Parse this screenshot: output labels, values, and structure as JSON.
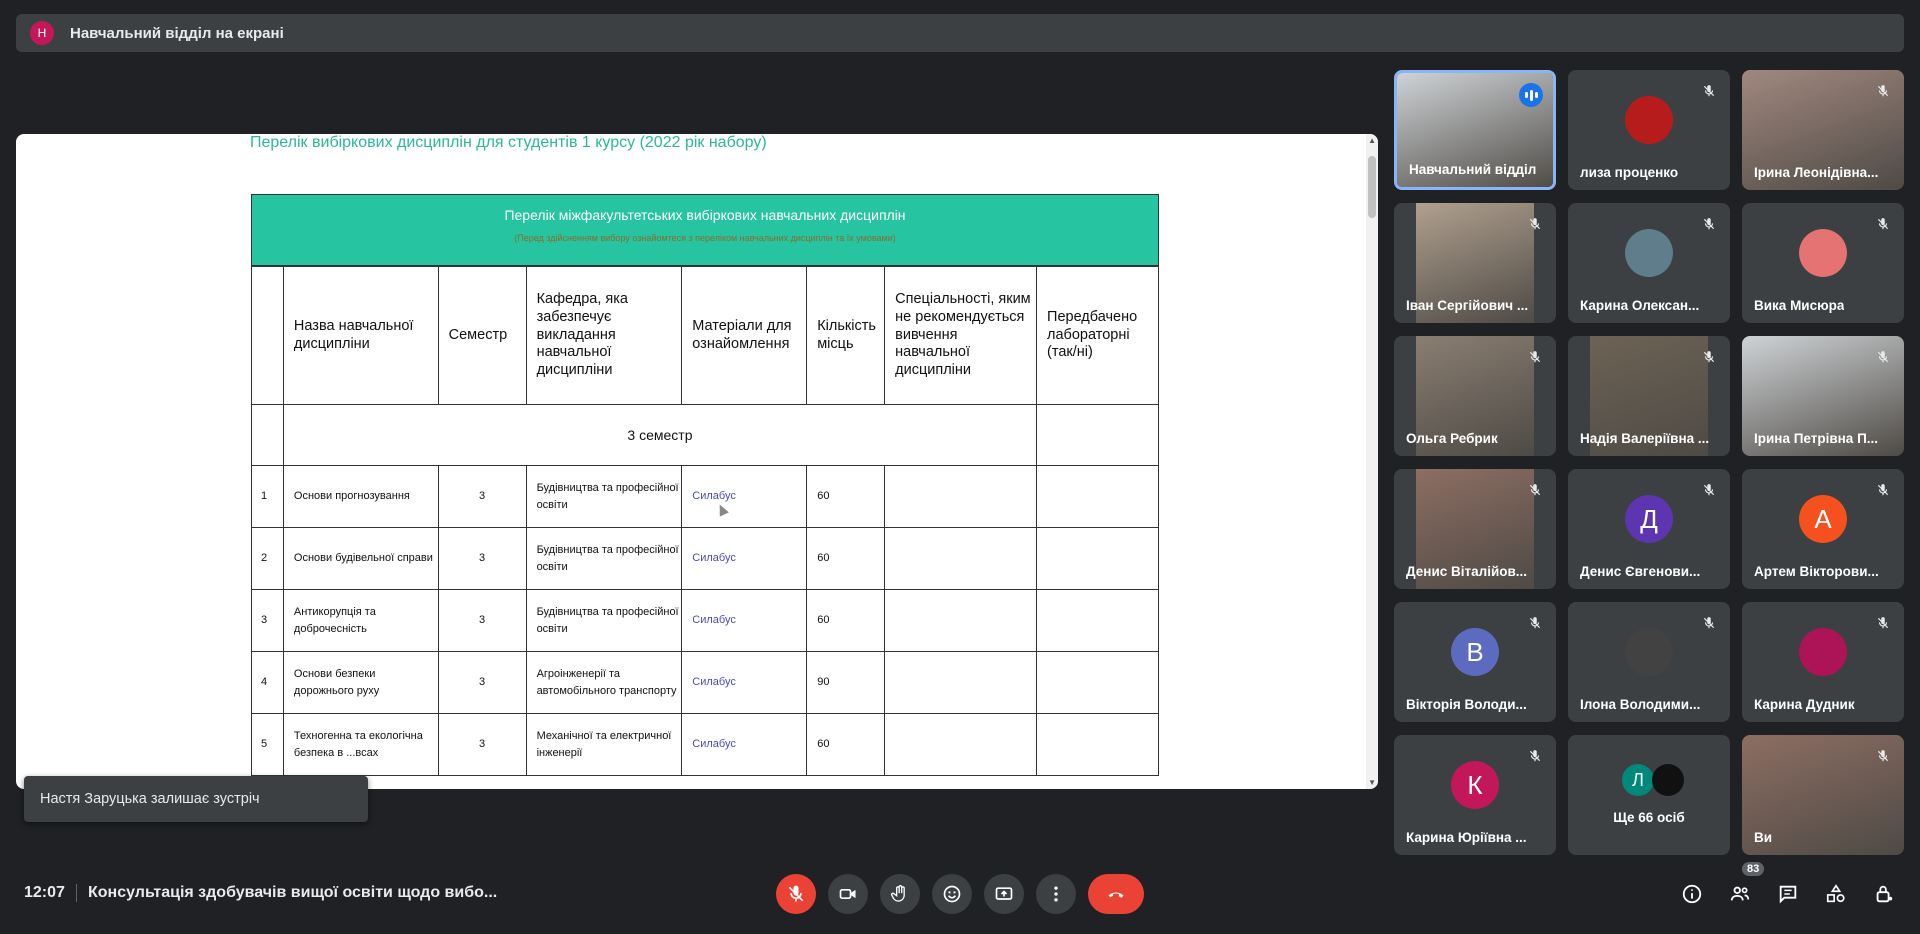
{
  "presenter": {
    "initial": "Н",
    "text": "Навчальний відділ на екрані"
  },
  "document": {
    "title": "Перелік вибіркових дисциплін для студентів 1 курсу (2022 рік набору)",
    "table_title": "Перелік міжфакультетських вибіркових навчальних дисциплін",
    "table_subtitle": "(Перед здійсненням вибору ознайомтеся з переліком навчальних дисциплін та їх умовами)",
    "headers": [
      "",
      "Назва навчальної дисципліни",
      "Семестр",
      "Кафедра, яка забезпечує викладання навчальної дисципліни",
      "Матеріали для ознайомлення",
      "Кількість місць",
      "Спеціальності, яким не рекомендується вивчення навчальної дисципліни",
      "Передбачено лабораторні (так/ні)"
    ],
    "semester_label": "3 семестр",
    "rows": [
      {
        "num": "1",
        "name": "Основи прогнозування",
        "sem": "3",
        "dept": "Будівництва та професійної освіти",
        "link": "Силабус",
        "places": "60"
      },
      {
        "num": "2",
        "name": "Основи будівельної справи",
        "sem": "3",
        "dept": "Будівництва та професійної освіти",
        "link": "Силабус",
        "places": "60"
      },
      {
        "num": "3",
        "name": "Антикорупція та доброчесність",
        "sem": "3",
        "dept": "Будівництва та професійної освіти",
        "link": "Силабус",
        "places": "60"
      },
      {
        "num": "4",
        "name": "Основи безпеки дорожнього руху",
        "sem": "3",
        "dept": "Агроінженерії та автомобільного транспорту",
        "link": "Силабус",
        "places": "90"
      },
      {
        "num": "5",
        "name": "Техногенна та екологічна безпека в ...всах",
        "sem": "3",
        "dept": "Механічної та електричної інженерії",
        "link": "Силабус",
        "places": "60"
      }
    ]
  },
  "toast": "Настя Заруцька залишає зустріч",
  "participants": [
    {
      "name": "Навчальний відділ",
      "kind": "camera",
      "speaking": true
    },
    {
      "name": "лиза проценко",
      "kind": "photo",
      "color": "#b71c1c"
    },
    {
      "name": "Ірина Леонідівна...",
      "kind": "camera"
    },
    {
      "name": "Іван Сергійович ...",
      "kind": "camera"
    },
    {
      "name": "Карина Олексан...",
      "kind": "photo",
      "color": "#607d8b"
    },
    {
      "name": "Вика Мисюра",
      "kind": "photo",
      "color": "#e57373"
    },
    {
      "name": "Ольга Ребрик",
      "kind": "camera"
    },
    {
      "name": "Надія Валеріївна ...",
      "kind": "camera"
    },
    {
      "name": "Ірина Петрівна П...",
      "kind": "camera"
    },
    {
      "name": "Денис Віталійов...",
      "kind": "camera"
    },
    {
      "name": "Денис Євгенови...",
      "kind": "letter",
      "letter": "Д",
      "color": "#5e35b1"
    },
    {
      "name": "Артем Вікторови...",
      "kind": "letter",
      "letter": "А",
      "color": "#f4511e"
    },
    {
      "name": "Вікторія Володи...",
      "kind": "letter",
      "letter": "В",
      "color": "#5c6bc0"
    },
    {
      "name": "Ілона Володими...",
      "kind": "photo",
      "color": "#424242"
    },
    {
      "name": "Карина Дудник",
      "kind": "photo",
      "color": "#ad1457"
    },
    {
      "name": "Карина Юріївна ...",
      "kind": "letter",
      "letter": "К",
      "color": "#c2185b"
    },
    {
      "name": "Ще 66 осіб",
      "kind": "more",
      "letter": "Л",
      "color": "#00897b"
    },
    {
      "name": "Ви",
      "kind": "camera"
    }
  ],
  "bottom": {
    "time": "12:07",
    "title": "Консультація здобувачів вищої освіти щодо вибо...",
    "participants_count": "83"
  },
  "colors": {
    "accent": "#26c4a0",
    "danger": "#ea4335",
    "active": "#8ab4f8"
  }
}
